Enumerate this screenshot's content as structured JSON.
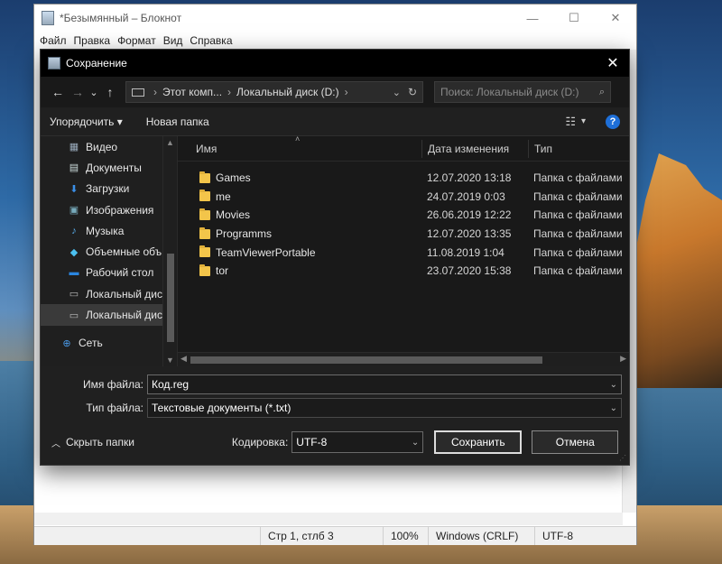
{
  "notepad": {
    "title": "*Безымянный – Блокнот",
    "controls": {
      "minimize": "—",
      "maximize": "☐",
      "close": "✕"
    },
    "menu": [
      "Файл",
      "Правка",
      "Формат",
      "Вид",
      "Справка"
    ],
    "status": {
      "position": "Стр 1, стлб 3",
      "zoom": "100%",
      "line_endings": "Windows (CRLF)",
      "encoding": "UTF-8"
    }
  },
  "dialog": {
    "title": "Сохранение",
    "close": "✕",
    "address": {
      "back": "←",
      "forward": "→",
      "recent": "⌄",
      "up": "↑",
      "crumbs": [
        "Этот комп...",
        "Локальный диск (D:)"
      ],
      "dropdown": "⌄",
      "refresh": "↻"
    },
    "search": {
      "placeholder": "Поиск: Локальный диск (D:)",
      "icon": "🔍"
    },
    "toolbar": {
      "organize": "Упорядочить ▾",
      "new_folder": "Новая папка",
      "view": "▾",
      "help": "?"
    },
    "nav": {
      "items": [
        {
          "label": "Видео",
          "icon": "video-icon",
          "glyph": "▦"
        },
        {
          "label": "Документы",
          "icon": "documents-icon",
          "glyph": "▤"
        },
        {
          "label": "Загрузки",
          "icon": "downloads-icon",
          "glyph": "⬇"
        },
        {
          "label": "Изображения",
          "icon": "pictures-icon",
          "glyph": "▣"
        },
        {
          "label": "Музыка",
          "icon": "music-icon",
          "glyph": "♪"
        },
        {
          "label": "Объемные объ",
          "icon": "3d-objects-icon",
          "glyph": "◆"
        },
        {
          "label": "Рабочий стол",
          "icon": "desktop-icon",
          "glyph": "▬"
        },
        {
          "label": "Локальный дис",
          "icon": "drive-icon",
          "glyph": "▭"
        },
        {
          "label": "Локальный дис",
          "icon": "drive-icon",
          "glyph": "▭"
        },
        {
          "label": "Сеть",
          "icon": "network-icon",
          "glyph": "⊕"
        }
      ]
    },
    "columns": {
      "name": "Имя",
      "date": "Дата изменения",
      "type": "Тип",
      "sort": "˄"
    },
    "files": [
      {
        "name": "Games",
        "date": "12.07.2020 13:18",
        "type": "Папка с файлами"
      },
      {
        "name": "me",
        "date": "24.07.2019 0:03",
        "type": "Папка с файлами"
      },
      {
        "name": "Movies",
        "date": "26.06.2019 12:22",
        "type": "Папка с файлами"
      },
      {
        "name": "Programms",
        "date": "12.07.2020 13:35",
        "type": "Папка с файлами"
      },
      {
        "name": "TeamViewerPortable",
        "date": "11.08.2019 1:04",
        "type": "Папка с файлами"
      },
      {
        "name": "tor",
        "date": "23.07.2020 15:38",
        "type": "Папка с файлами"
      }
    ],
    "filename": {
      "label": "Имя файла:",
      "value": "Код.reg"
    },
    "filetype": {
      "label": "Тип файла:",
      "value": "Текстовые документы (*.txt)"
    },
    "hide_folders": "Скрыть папки",
    "encoding": {
      "label": "Кодировка:",
      "value": "UTF-8"
    },
    "save_button": "Сохранить",
    "cancel_button": "Отмена"
  }
}
